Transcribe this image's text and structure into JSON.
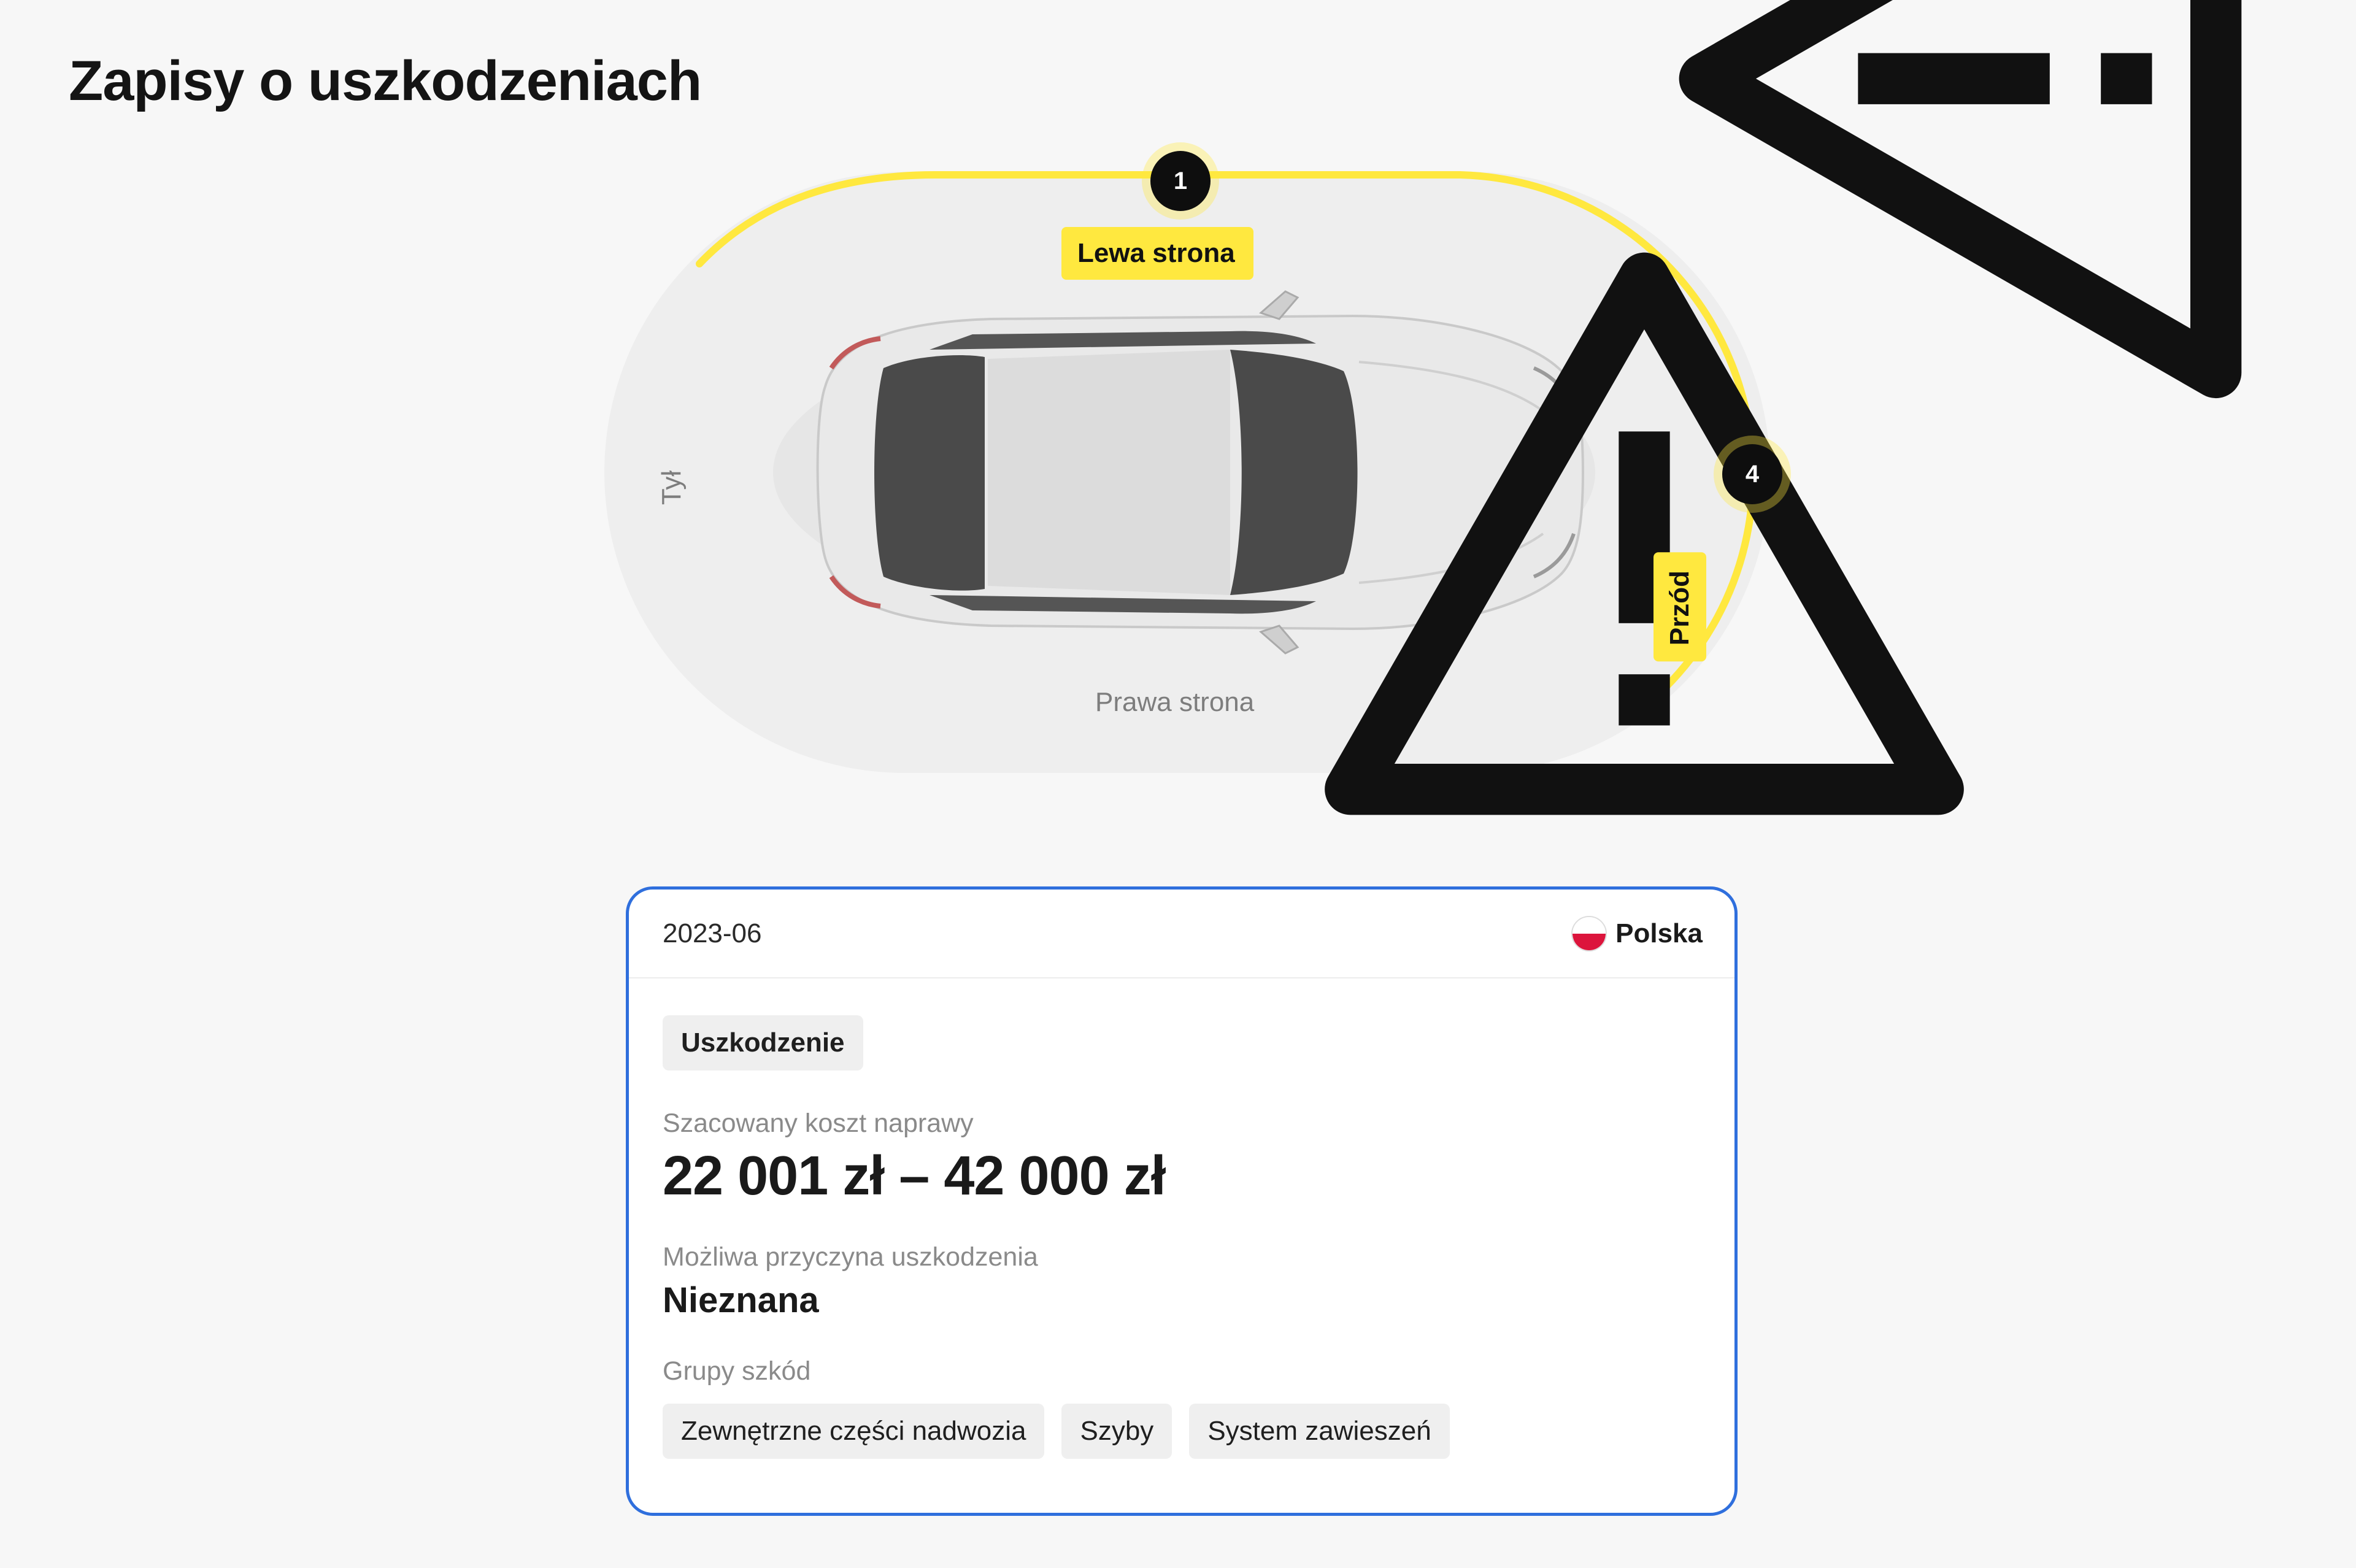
{
  "page": {
    "title": "Zapisy o uszkodzeniach"
  },
  "diagram": {
    "sides": {
      "left": "Lewa strona",
      "front": "Przód",
      "right": "Prawa strona",
      "rear": "Tył"
    },
    "markers": {
      "left_count": "1",
      "front_count": "4"
    },
    "colors": {
      "highlight": "#ffe83f",
      "marker": "#0e0e0e",
      "zone": "#eeeeee"
    },
    "icons": {
      "warning": "warning-triangle-icon"
    }
  },
  "card": {
    "date": "2023-06",
    "country": "Polska",
    "type_chip": "Uszkodzenie",
    "cost_label": "Szacowany koszt naprawy",
    "cost_value": "22 001 zł – 42 000 zł",
    "cause_label": "Możliwa przyczyna uszkodzenia",
    "cause_value": "Nieznana",
    "groups_label": "Grupy szkód",
    "groups": [
      "Zewnętrzne części nadwozia",
      "Szyby",
      "System zawieszeń"
    ],
    "border_color": "#2f6fdd"
  }
}
